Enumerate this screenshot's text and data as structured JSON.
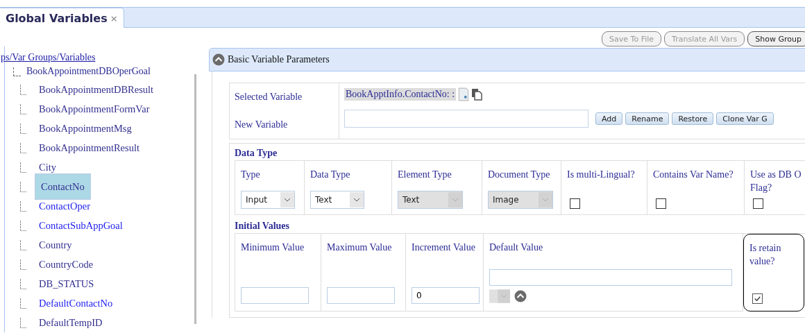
{
  "tab": {
    "title": "Global Variables",
    "close": "×",
    "selected": true
  },
  "toolbar": [
    {
      "label": "Save To File",
      "disabled": true
    },
    {
      "label": "Translate All Vars",
      "disabled": true
    },
    {
      "label": "Show Group",
      "disabled": false
    }
  ],
  "tree": {
    "breadcrumb": "ps/Var Groups/Variables",
    "root": {
      "label": "BookAppointmentDBOperGoal",
      "children": [
        {
          "label": "BookAppointmentDBResult",
          "selected": false,
          "visited": true
        },
        {
          "label": "BookAppointmentFormVar",
          "selected": false,
          "visited": true
        },
        {
          "label": "BookAppointmentMsg",
          "selected": false,
          "visited": true
        },
        {
          "label": "BookAppointmentResult",
          "selected": false,
          "visited": true
        },
        {
          "label": "City",
          "selected": false,
          "visited": true
        },
        {
          "label": "ContactNo",
          "selected": true,
          "visited": true
        },
        {
          "label": "ContactOper",
          "selected": false,
          "visited": false
        },
        {
          "label": "ContactSubAppGoal",
          "selected": false,
          "visited": false
        },
        {
          "label": "Country",
          "selected": false,
          "visited": true
        },
        {
          "label": "CountryCode",
          "selected": false,
          "visited": true
        },
        {
          "label": "DB_STATUS",
          "selected": false,
          "visited": true
        },
        {
          "label": "DefaultContactNo",
          "selected": false,
          "visited": false
        },
        {
          "label": "DefaultTempID",
          "selected": false,
          "visited": true
        }
      ]
    }
  },
  "panel": {
    "title": "Basic Variable Parameters",
    "expanded": true,
    "selected_variable": {
      "label": "Selected Variable",
      "value": "BookApptInfo.ContactNo: :"
    },
    "new_variable": {
      "label": "New Variable"
    },
    "actions": [
      "Add",
      "Rename",
      "Restore",
      "Clone Var G"
    ],
    "data_type": {
      "title": "Data Type",
      "fields": [
        {
          "kind": "select",
          "label": "Type",
          "value": "Input",
          "disabled": false
        },
        {
          "kind": "select",
          "label": "Data Type",
          "value": "Text",
          "disabled": false
        },
        {
          "kind": "select",
          "label": "Element Type",
          "value": "Text",
          "disabled": true
        },
        {
          "kind": "select",
          "label": "Document Type",
          "value": "Image",
          "disabled": true
        },
        {
          "kind": "checkbox",
          "label": "Is multi-Lingual?",
          "checked": false
        },
        {
          "kind": "checkbox",
          "label": "Contains Var Name?",
          "checked": false
        },
        {
          "kind": "checkbox",
          "label": "Use as DB O Flag?",
          "checked": false
        }
      ]
    },
    "initial_values": {
      "title": "Initial Values",
      "fields": [
        {
          "kind": "input",
          "label": "Minimum Value"
        },
        {
          "kind": "input",
          "label": "Maximum Value"
        },
        {
          "kind": "input",
          "label": "Increment Value",
          "value": "0"
        },
        {
          "kind": "default",
          "label": "Default Value"
        },
        {
          "kind": "checkbox",
          "label": "Is retain value?",
          "checked": true,
          "highlighted": true
        }
      ]
    }
  }
}
